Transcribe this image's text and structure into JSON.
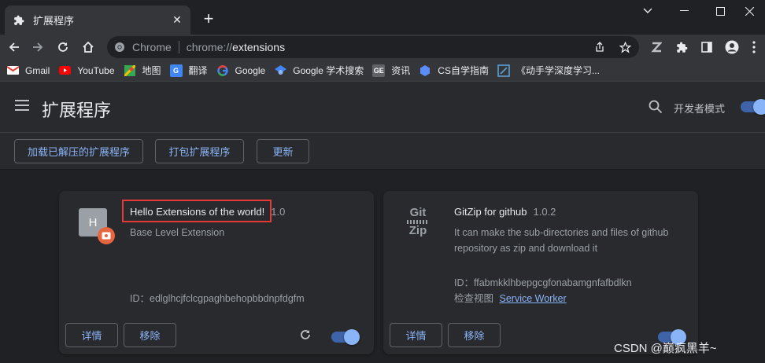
{
  "tab": {
    "title": "扩展程序",
    "favicon": "puzzle-icon"
  },
  "omnibox": {
    "chip_label": "Chrome",
    "url_prefix": "chrome://",
    "url_host": "extensions"
  },
  "bookmarks": [
    {
      "label": "Gmail",
      "icon": "gmail-icon",
      "color": "#ea4335"
    },
    {
      "label": "YouTube",
      "icon": "youtube-icon",
      "color": "#ff0000"
    },
    {
      "label": "地图",
      "icon": "maps-icon",
      "color": "#34a853"
    },
    {
      "label": "翻译",
      "icon": "translate-icon",
      "color": "#4285f4"
    },
    {
      "label": "Google",
      "icon": "google-icon",
      "color": "#4285f4"
    },
    {
      "label": "Google 学术搜索",
      "icon": "scholar-icon",
      "color": "#4285f4"
    },
    {
      "label": "资讯",
      "icon": "news-icon",
      "color": "#4285f4"
    },
    {
      "label": "CS自学指南",
      "icon": "cs-guide-icon",
      "color": "#5c8df6"
    },
    {
      "label": "《动手学深度学习...",
      "icon": "d2l-icon",
      "color": "#5c9fd6"
    }
  ],
  "header": {
    "title": "扩展程序",
    "dev_mode_label": "开发者模式",
    "dev_mode_on": true
  },
  "actions": {
    "load_unpacked": "加载已解压的扩展程序",
    "pack": "打包扩展程序",
    "update": "更新"
  },
  "extensions": [
    {
      "icon_letter": "H",
      "name": "Hello Extensions of the world!",
      "version": "1.0",
      "description": "Base Level Extension",
      "id_line": "ID：edlglhcjfclcgpaghbehopbbdnpfdgfm",
      "details_label": "详情",
      "remove_label": "移除",
      "enabled": true
    },
    {
      "icon_text": [
        "Git",
        "Zip"
      ],
      "name": "GitZip for github",
      "version": "1.0.2",
      "description": "It can make the sub-directories and files of github repository as zip and download it",
      "id_line": "ID：ffabmkklhbepgcgfonabamgnfafbdlkn",
      "inspect_label": "检查视图",
      "inspect_link": "Service Worker",
      "details_label": "详情",
      "remove_label": "移除",
      "enabled": true
    }
  ],
  "watermark": "CSDN @巅疯黑羊~",
  "colors": {
    "accent": "#8ab4f8",
    "highlight": "#e53935",
    "surface": "#292a2d",
    "background": "#202124"
  }
}
